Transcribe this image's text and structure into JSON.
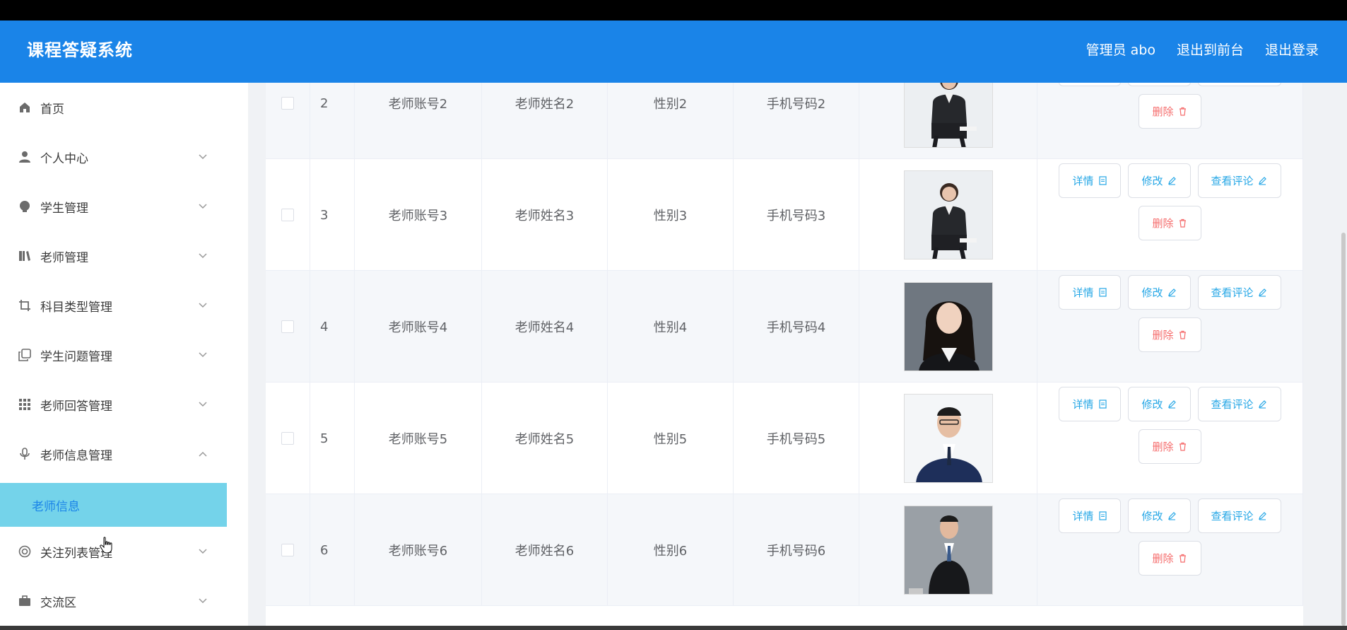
{
  "app": {
    "title": "课程答疑系统"
  },
  "header": {
    "user": "管理员 abo",
    "to_front": "退出到前台",
    "logout": "退出登录"
  },
  "sidebar": {
    "items": [
      {
        "label": "首页",
        "icon": "home-icon"
      },
      {
        "label": "个人中心",
        "icon": "user-icon"
      },
      {
        "label": "学生管理",
        "icon": "bulb-icon"
      },
      {
        "label": "老师管理",
        "icon": "books-icon"
      },
      {
        "label": "科目类型管理",
        "icon": "crop-icon"
      },
      {
        "label": "学生问题管理",
        "icon": "copy-icon"
      },
      {
        "label": "老师回答管理",
        "icon": "grid-icon"
      },
      {
        "label": "老师信息管理",
        "icon": "mic-icon"
      },
      {
        "label": "关注列表管理",
        "icon": "lifebuoy-icon"
      },
      {
        "label": "交流区",
        "icon": "briefcase-icon"
      }
    ],
    "active_sub": "老师信息"
  },
  "actions": {
    "detail": "详情",
    "edit": "修改",
    "comments": "查看评论",
    "delete": "删除"
  },
  "colors": {
    "header": "#1a84e8",
    "active_sub": "#74d3ea",
    "info": "#26a7e6",
    "danger": "#f56c6c"
  },
  "rows": [
    {
      "idx": "2",
      "account": "老师账号2",
      "name": "老师姓名2",
      "gender": "性别2",
      "phone": "手机号码2",
      "photo": "woman-suit-sitting"
    },
    {
      "idx": "3",
      "account": "老师账号3",
      "name": "老师姓名3",
      "gender": "性别3",
      "phone": "手机号码3",
      "photo": "woman-suit-sitting"
    },
    {
      "idx": "4",
      "account": "老师账号4",
      "name": "老师姓名4",
      "gender": "性别4",
      "phone": "手机号码4",
      "photo": "woman-portrait"
    },
    {
      "idx": "5",
      "account": "老师账号5",
      "name": "老师姓名5",
      "gender": "性别5",
      "phone": "手机号码5",
      "photo": "man-navy-suit"
    },
    {
      "idx": "6",
      "account": "老师账号6",
      "name": "老师姓名6",
      "gender": "性别6",
      "phone": "手机号码6",
      "photo": "man-black-suit"
    }
  ]
}
